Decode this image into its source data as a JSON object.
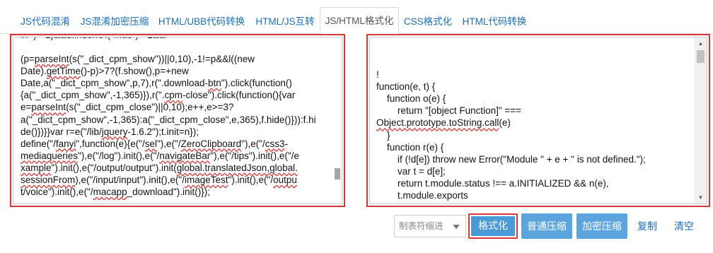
{
  "tabs": [
    {
      "label": "JS代码混淆",
      "active": false
    },
    {
      "label": "JS混淆加密压缩",
      "active": false
    },
    {
      "label": "HTML/UBB代码转换",
      "active": false
    },
    {
      "label": "HTML/JS互转",
      "active": false
    },
    {
      "label": "JS/HTML格式化",
      "active": true
    },
    {
      "label": "CSS格式化",
      "active": false
    },
    {
      "label": "HTML代码转换",
      "active": false
    }
  ],
  "input_code": {
    "lines": [
      "(p=parseInt(s(\"_dict_cpm_show\"))||0,10),-1!=p&&l((new",
      "Date).getTime()-p)>7?(f.show(),p=+new",
      "Date,a(\"_dict_cpm_show\",p,7),r(\".download-btn\").click(function()",
      "{a(\"_dict_cpm_show\",-1,365)}),r(\".cpm-close\").click(function(){var",
      "e=parseInt(s(\"_dict_cpm_close\")||0,10);e++,e>=3?",
      "a(\"_dict_cpm_show\",-1,365):a(\"_dict_cpm_close\",e,365),f.hide()})):f.hi",
      "de()})}}var r=e(\"/lib/jquery-1.6.2\");t.init=n});",
      "define(\"/fanyi\",function(e){e(\"/sel\"),e(\"/ZeroClipboard\"),e(\"/css3-",
      "mediaqueries\"),e(\"/log\").init(),e(\"/navigateBar\"),e(\"/tips\").init(),e(\"/e",
      "xample\").init(),e(\"/output/output\").init(global.translatedJson,global.",
      "sessionFrom),e(\"/input/input\").init(),e(\"/imageTest\").init(),e(\"/outpu",
      "t/voice\").init(),e(\"/macapp_download\").init()});"
    ]
  },
  "output_code": {
    "lines": [
      "!",
      "function(e, t) {",
      "    function o(e) {",
      "        return \"[object Function]\" ===",
      "Object.prototype.toString.call(e)",
      "    }",
      "    function r(e) {",
      "        if (!d[e]) throw new Error(\"Module \" + e + \" is not defined.\");",
      "        var t = d[e];",
      "        return t.module.status !== a.INITIALIZED && n(e),",
      "        t.module.exports",
      "    }"
    ]
  },
  "indent_select": {
    "value": "制表符缩进"
  },
  "buttons": {
    "format": "格式化",
    "compress": "普通压缩",
    "encrypt_compress": "加密压缩",
    "copy": "复制",
    "clear": "清空"
  },
  "colors": {
    "highlight_border": "#d93838",
    "button_blue": "#5ba4de",
    "tab_link": "#1a6fbf"
  }
}
